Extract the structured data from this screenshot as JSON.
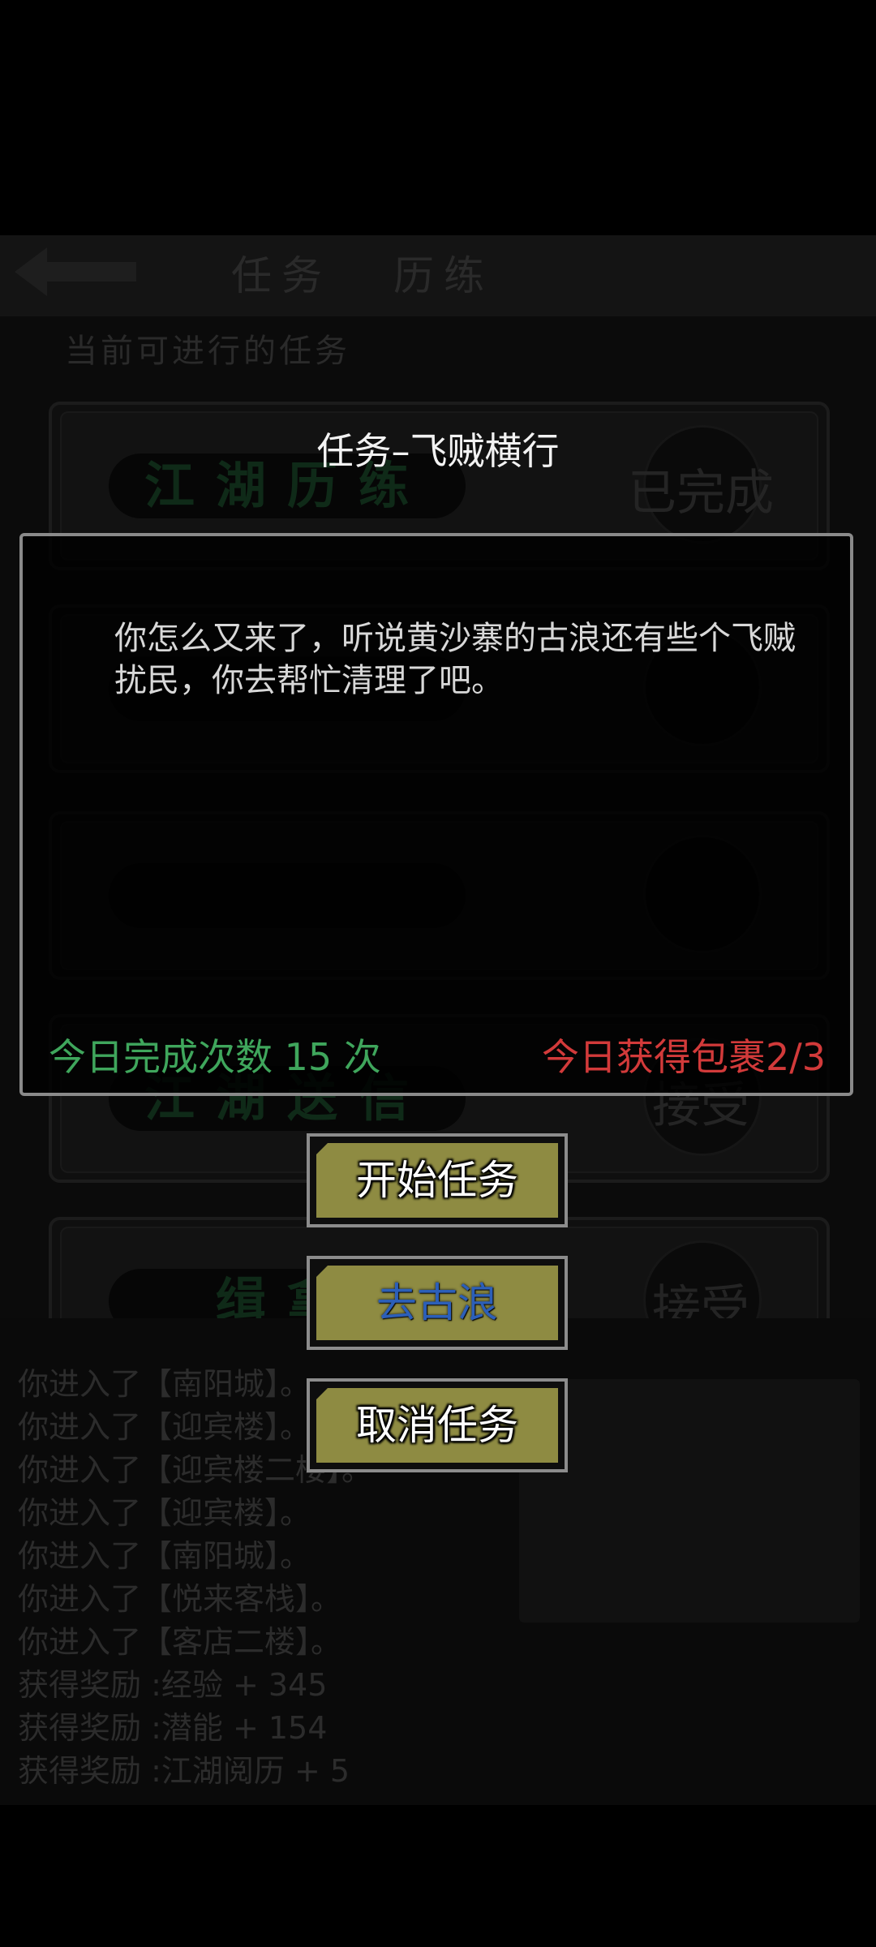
{
  "background": {
    "tabs": [
      "任务",
      "历练"
    ],
    "subtitle": "当前可进行的任务",
    "tasks": [
      {
        "name": "江湖历练",
        "status": "已完成"
      },
      {
        "name": "",
        "status": ""
      },
      {
        "name": "",
        "status": ""
      },
      {
        "name": "江湖送信",
        "status": "接受"
      },
      {
        "name": "缉拿",
        "status": "接受"
      }
    ],
    "log": [
      "你进入了【南阳城】。",
      "你进入了【迎宾楼】。",
      "你进入了【迎宾楼二楼】。",
      "你进入了【迎宾楼】。",
      "你进入了【南阳城】。",
      "你进入了【悦来客栈】。",
      "你进入了【客店二楼】。",
      "获得奖励 :经验 + 345",
      "获得奖励 :潜能 + 154",
      "获得奖励 :江湖阅历 + 5"
    ]
  },
  "dialog": {
    "title": "任务–飞贼横行",
    "message": "你怎么又来了，听说黄沙寨的古浪还有些个飞贼扰民，你去帮忙清理了吧。",
    "completed_today": "今日完成次数 15 次",
    "packages_today": "今日获得包裹2/3"
  },
  "buttons": {
    "start": "开始任务",
    "goto": "去古浪",
    "cancel": "取消任务"
  },
  "colors": {
    "completed_green": "#3fa65c",
    "package_red": "#d23a3a",
    "button_olive": "#8e8b42",
    "goto_blue": "#2c5fb8"
  }
}
